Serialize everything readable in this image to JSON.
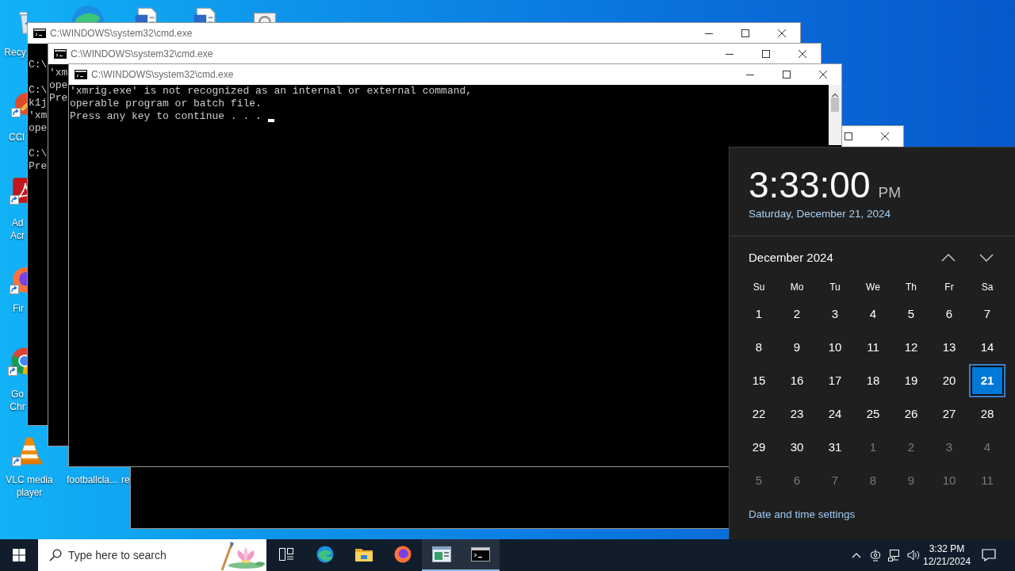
{
  "desktop_icons": [
    {
      "kind": "recycle",
      "lines": [
        "Recy"
      ]
    },
    {
      "kind": "edge"
    },
    {
      "kind": "document"
    },
    {
      "kind": "document"
    },
    {
      "kind": "setup"
    },
    {
      "kind": "broom",
      "shortcut": true,
      "lines": [
        "CCl"
      ]
    },
    {
      "kind": "pdf",
      "shortcut": true,
      "lines": [
        "Ad",
        "Acr"
      ]
    },
    {
      "kind": "firefox",
      "shortcut": true,
      "lines": [
        "Fir"
      ]
    },
    {
      "kind": "chrome",
      "shortcut": true,
      "lines": [
        "Go",
        "Chr"
      ]
    },
    {
      "kind": "cone",
      "shortcut": true,
      "lines": [
        "VLC media",
        "player"
      ]
    },
    {
      "lines": [
        "footballcla..."
      ]
    },
    {
      "lines": [
        "re"
      ]
    }
  ],
  "windows": [
    {
      "kind": "partial"
    },
    {
      "kind": "back",
      "title": "C:\\WINDOWS\\system32\\cmd.exe",
      "blocks": [
        [
          "C:\\"
        ],
        [
          "C:\\",
          "k1j",
          "'xm",
          "ope"
        ],
        [
          "C:\\",
          "Pre"
        ]
      ]
    },
    {
      "kind": "back",
      "title": "C:\\WINDOWS\\system32\\cmd.exe",
      "blocks": [
        [
          "'xm",
          "ope",
          "Pre"
        ]
      ]
    },
    {
      "kind": "front",
      "title": "C:\\WINDOWS\\system32\\cmd.exe",
      "blocks": [
        [
          "'xmrig.exe' is not recognized as an internal or external command,",
          "operable program or batch file.",
          "Press any key to continue . . ."
        ]
      ],
      "cursor": true
    }
  ],
  "clock_flyout": {
    "time": "3:33:00",
    "meridiem": "PM",
    "date": "Saturday, December 21, 2024",
    "month": "December 2024",
    "weekdays": [
      "Su",
      "Mo",
      "Tu",
      "We",
      "Th",
      "Fr",
      "Sa"
    ],
    "days": [
      {
        "text": "1",
        "kind": "current",
        "selected": false
      },
      {
        "text": "2",
        "kind": "current",
        "selected": false
      },
      {
        "text": "3",
        "kind": "current",
        "selected": false
      },
      {
        "text": "4",
        "kind": "current",
        "selected": false
      },
      {
        "text": "5",
        "kind": "current",
        "selected": false
      },
      {
        "text": "6",
        "kind": "current",
        "selected": false
      },
      {
        "text": "7",
        "kind": "current",
        "selected": false
      },
      {
        "text": "8",
        "kind": "current",
        "selected": false
      },
      {
        "text": "9",
        "kind": "current",
        "selected": false
      },
      {
        "text": "10",
        "kind": "current",
        "selected": false
      },
      {
        "text": "11",
        "kind": "current",
        "selected": false
      },
      {
        "text": "12",
        "kind": "current",
        "selected": false
      },
      {
        "text": "13",
        "kind": "current",
        "selected": false
      },
      {
        "text": "14",
        "kind": "current",
        "selected": false
      },
      {
        "text": "15",
        "kind": "current",
        "selected": false
      },
      {
        "text": "16",
        "kind": "current",
        "selected": false
      },
      {
        "text": "17",
        "kind": "current",
        "selected": false
      },
      {
        "text": "18",
        "kind": "current",
        "selected": false
      },
      {
        "text": "19",
        "kind": "current",
        "selected": false
      },
      {
        "text": "20",
        "kind": "current",
        "selected": false
      },
      {
        "text": "21",
        "kind": "current",
        "selected": true
      },
      {
        "text": "22",
        "kind": "current",
        "selected": false
      },
      {
        "text": "23",
        "kind": "current",
        "selected": false
      },
      {
        "text": "24",
        "kind": "current",
        "selected": false
      },
      {
        "text": "25",
        "kind": "current",
        "selected": false
      },
      {
        "text": "26",
        "kind": "current",
        "selected": false
      },
      {
        "text": "27",
        "kind": "current",
        "selected": false
      },
      {
        "text": "28",
        "kind": "current",
        "selected": false
      },
      {
        "text": "29",
        "kind": "current",
        "selected": false
      },
      {
        "text": "30",
        "kind": "current",
        "selected": false
      },
      {
        "text": "31",
        "kind": "current",
        "selected": false
      },
      {
        "text": "1",
        "kind": "other",
        "selected": false
      },
      {
        "text": "2",
        "kind": "other",
        "selected": false
      },
      {
        "text": "3",
        "kind": "other",
        "selected": false
      },
      {
        "text": "4",
        "kind": "other",
        "selected": false
      },
      {
        "text": "5",
        "kind": "other",
        "selected": false
      },
      {
        "text": "6",
        "kind": "other",
        "selected": false
      },
      {
        "text": "7",
        "kind": "other",
        "selected": false
      },
      {
        "text": "8",
        "kind": "other",
        "selected": false
      },
      {
        "text": "9",
        "kind": "other",
        "selected": false
      },
      {
        "text": "10",
        "kind": "other",
        "selected": false
      },
      {
        "text": "11",
        "kind": "other",
        "selected": false
      }
    ],
    "settings_link": "Date and time settings"
  },
  "taskbar": {
    "search": {
      "placeholder": "Type here to search"
    },
    "apps": [
      {
        "kind": "taskview",
        "running": false
      },
      {
        "kind": "edge",
        "running": false
      },
      {
        "kind": "folder",
        "running": false
      },
      {
        "kind": "firefox",
        "running": false
      },
      {
        "kind": "window",
        "running": true
      },
      {
        "kind": "console",
        "running": true
      }
    ],
    "clock": {
      "time": "3:32 PM",
      "date": "12/21/2024"
    }
  }
}
